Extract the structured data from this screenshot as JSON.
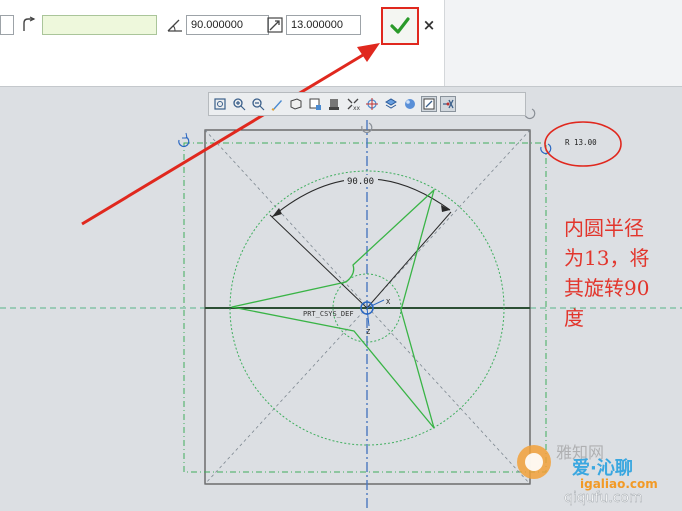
{
  "dashboard": {
    "field_1_value": "",
    "field_2_value": "",
    "angle_value": "90.000000",
    "radius_value": "13.000000",
    "angle_icon": "angle-icon",
    "radius_icon": "radius-arrow-icon",
    "corner_icon": "corner-icon",
    "ok_icon": "checkmark-icon",
    "cancel_label": "×",
    "ok_color": "#2a9a2a",
    "highlight_color": "#e0281e"
  },
  "toolbar": {
    "icons": [
      "refit-icon",
      "zoom-in-icon",
      "zoom-out-icon",
      "repaint-icon",
      "display-style-icon",
      "saved-views-icon",
      "datum-display-icon",
      "annotation-display-icon",
      "spin-center-icon",
      "layers-icon",
      "render-icon",
      "sketch-view-icon",
      "sketch-display-icon"
    ]
  },
  "sketch": {
    "angle_dimension": "90.00",
    "radius_dimension": "R 13.00",
    "csys_label": "PRT_CSYS_DEF",
    "x_axis_label": "X",
    "z_axis_label": "Z"
  },
  "annotation": {
    "line_1": "内圆半径",
    "line_2": "为13，将",
    "line_3": "其旋转90",
    "line_4": "度",
    "color": "#e2352c"
  },
  "watermark": {
    "text_1": "雅知网",
    "text_2": "爱·沁聊",
    "text_3": "igaliao.com",
    "text_4": "qiqufu.com"
  }
}
